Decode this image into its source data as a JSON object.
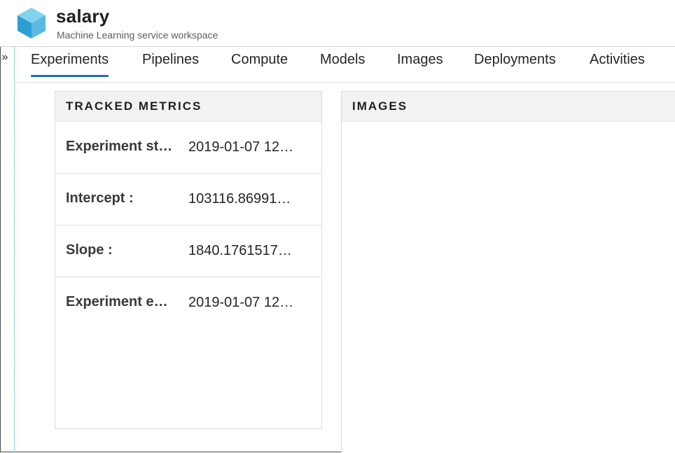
{
  "workspace": {
    "name": "salary",
    "subtitle": "Machine Learning service workspace",
    "logo_icon": "cube-icon",
    "logo_colors": {
      "top": "#7fd3ea",
      "left": "#2aa0d2",
      "right": "#5ab9e0"
    }
  },
  "rail": {
    "toggle_glyph": "»",
    "toggle_icon": "expand-chevrons-icon"
  },
  "tabs": [
    {
      "label": "Experiments",
      "active": true
    },
    {
      "label": "Pipelines",
      "active": false
    },
    {
      "label": "Compute",
      "active": false
    },
    {
      "label": "Models",
      "active": false
    },
    {
      "label": "Images",
      "active": false
    },
    {
      "label": "Deployments",
      "active": false
    },
    {
      "label": "Activities",
      "active": false
    }
  ],
  "tracked_metrics": {
    "title": "TRACKED METRICS",
    "rows": [
      {
        "name": "Experiment st…",
        "value": "2019-01-07 12…"
      },
      {
        "name": "Intercept :",
        "value": "103116.86991…"
      },
      {
        "name": "Slope :",
        "value": "1840.1761517…"
      },
      {
        "name": "Experiment e…",
        "value": "2019-01-07 12…"
      }
    ]
  },
  "images_panel": {
    "title": "IMAGES"
  },
  "colors": {
    "accent": "#1f6ac5",
    "panel_header_bg": "#f2f2f2",
    "rail_border": "#2aa3b8"
  }
}
